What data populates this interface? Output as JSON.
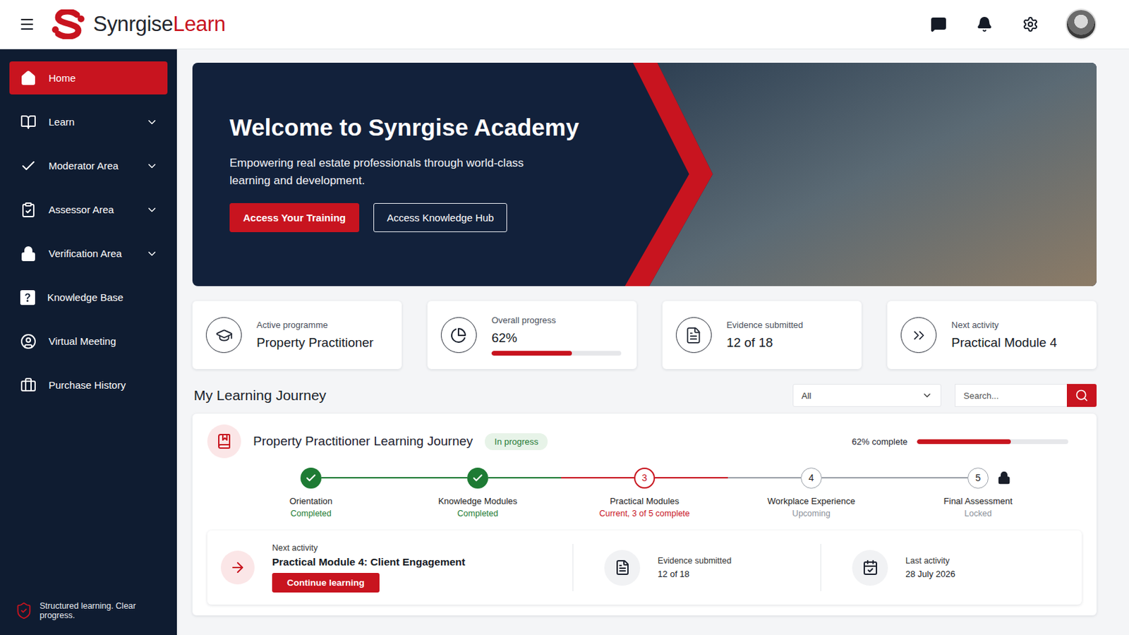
{
  "header": {
    "brand_primary": "Synrgise",
    "brand_accent": "Learn"
  },
  "sidebar": {
    "items": [
      {
        "label": "Home",
        "selected": true,
        "expandable": false
      },
      {
        "label": "Learn",
        "selected": false,
        "expandable": true
      },
      {
        "label": "Moderator Area",
        "selected": false,
        "expandable": true
      },
      {
        "label": "Assessor Area",
        "selected": false,
        "expandable": true
      },
      {
        "label": "Verification Area",
        "selected": false,
        "expandable": true
      },
      {
        "label": "Knowledge Base",
        "selected": false,
        "expandable": false
      },
      {
        "label": "Virtual Meeting",
        "selected": false,
        "expandable": false
      },
      {
        "label": "Purchase History",
        "selected": false,
        "expandable": false
      }
    ],
    "footer": "Structured learning. Clear progress."
  },
  "hero": {
    "title": "Welcome to Synrgise Academy",
    "subtitle": "Empowering real estate professionals through world-class learning and development.",
    "buttons": [
      {
        "label": "Access Your Training",
        "kind": "primary"
      },
      {
        "label": "Access Knowledge Hub",
        "kind": "outline"
      }
    ]
  },
  "stats": [
    {
      "label": "Active programme",
      "value": "Property Practitioner",
      "kind": "text"
    },
    {
      "label": "Overall progress",
      "value": "62%",
      "kind": "progress",
      "level": 0.62
    },
    {
      "label": "Evidence submitted",
      "value": "12 of 18",
      "kind": "text"
    },
    {
      "label": "Next activity",
      "value": "Practical Module 4",
      "kind": "text"
    }
  ],
  "journey": {
    "heading": "My Learning Journey",
    "filter": {
      "value": "All"
    },
    "search": {
      "placeholder": "Search..."
    },
    "card": {
      "title": "Property Practitioner Learning Journey",
      "badge": "In progress",
      "progress_label": "62% complete",
      "level": 0.62,
      "steps": [
        {
          "label": "Orientation",
          "status": "Completed",
          "kind": "completed"
        },
        {
          "label": "Knowledge Modules",
          "status": "Completed",
          "kind": "completed"
        },
        {
          "number": "3",
          "label": "Practical Modules",
          "status": "Current, 3 of 5 complete",
          "kind": "current"
        },
        {
          "number": "4",
          "label": "Workplace Experience",
          "status": "Upcoming",
          "kind": "upcoming"
        },
        {
          "number": "5",
          "label": "Final Assessment",
          "status": "Locked",
          "kind": "locked"
        }
      ],
      "next": {
        "label": "Next activity",
        "title": "Practical Module 4: Client Engagement",
        "button": "Continue learning"
      },
      "details": [
        {
          "label": "Evidence submitted",
          "value": "12 of 18"
        },
        {
          "label": "Last activity",
          "value": "28 July 2026"
        }
      ]
    }
  }
}
